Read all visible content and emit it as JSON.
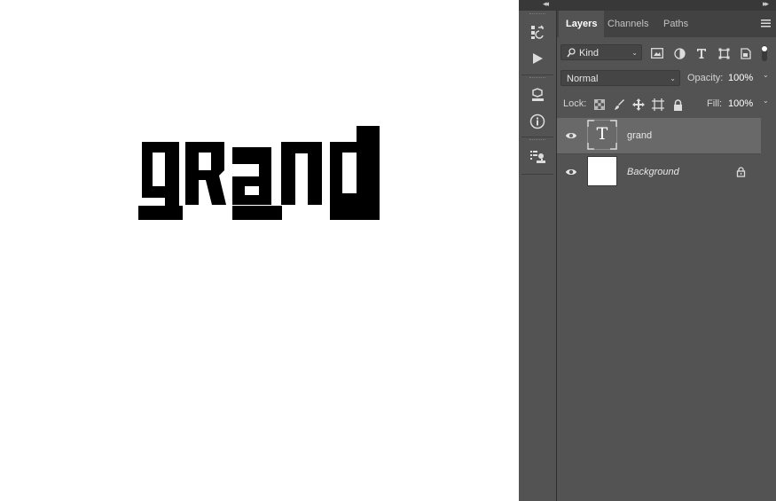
{
  "canvas": {
    "text": "grand",
    "text_color": "#000000",
    "background": "#ffffff"
  },
  "panel": {
    "tabs": [
      {
        "label": "Layers",
        "active": true
      },
      {
        "label": "Channels",
        "active": false
      },
      {
        "label": "Paths",
        "active": false
      }
    ],
    "filter": {
      "kind_label": "Kind"
    },
    "blend": {
      "mode": "Normal",
      "opacity_label": "Opacity:",
      "opacity_value": "100%"
    },
    "lock": {
      "label": "Lock:",
      "fill_label": "Fill:",
      "fill_value": "100%"
    },
    "layers": [
      {
        "name": "grand",
        "type": "text",
        "thumb_glyph": "T",
        "selected": true,
        "locked": false
      },
      {
        "name": "Background",
        "type": "pixel",
        "selected": false,
        "locked": true
      }
    ]
  },
  "colors": {
    "panel_bg": "#535353",
    "panel_dark": "#424242",
    "selected_row": "#696969",
    "field_bg": "#454545"
  },
  "icons": {
    "toolstrip": [
      "history-icon",
      "play-actions-icon",
      "3d-cube-icon",
      "info-icon",
      "clone-source-icon"
    ],
    "filter": [
      "image-filter-icon",
      "adjustment-filter-icon",
      "type-filter-icon",
      "shape-filter-icon",
      "smart-object-filter-icon"
    ],
    "lock": [
      "lock-transparent-icon",
      "lock-paint-icon",
      "lock-position-icon",
      "lock-artboard-icon",
      "lock-all-icon"
    ]
  }
}
